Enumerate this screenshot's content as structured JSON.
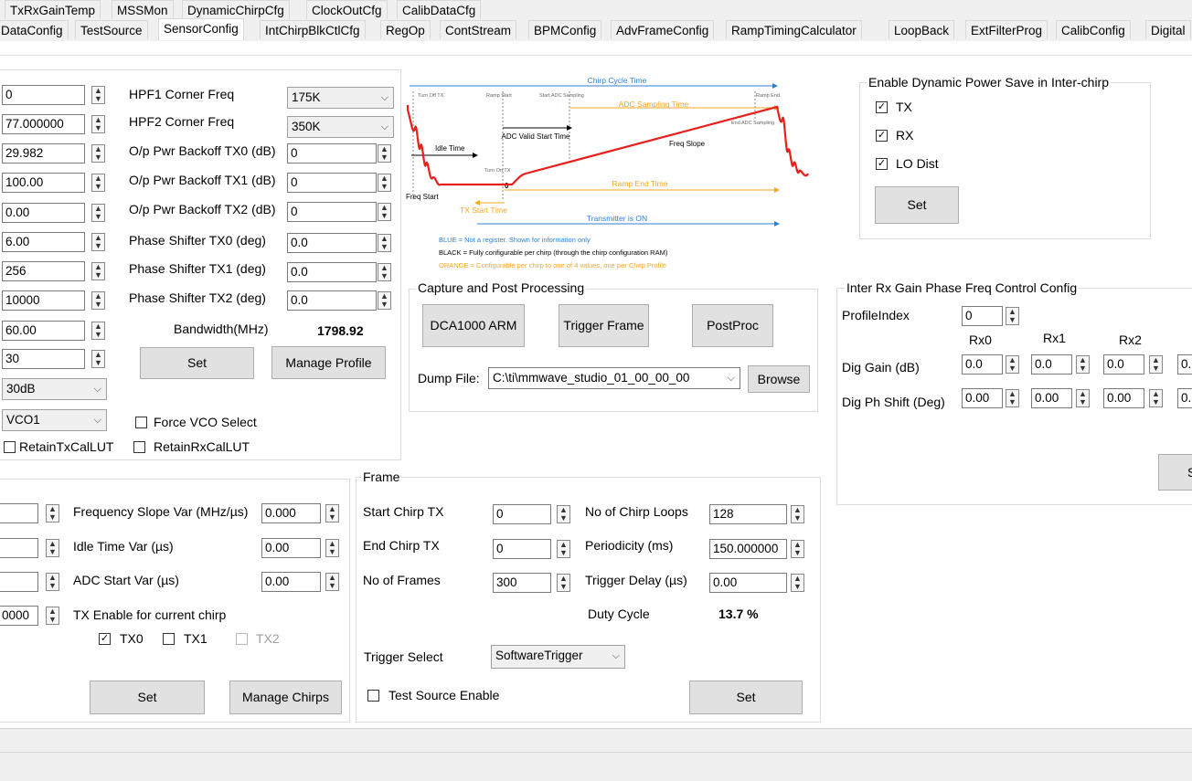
{
  "tabs_row1": [
    "TxRxGainTemp",
    "MSSMon",
    "DynamicChirpCfg",
    "ClockOutCfg",
    "CalibDataCfg"
  ],
  "tabs_row2": [
    "DataConfig",
    "TestSource",
    "SensorConfig",
    "IntChirpBlkCtlCfg",
    "RegOp",
    "ContStream",
    "BPMConfig",
    "AdvFrameConfig",
    "RampTimingCalculator",
    "LoopBack",
    "ExtFilterProg",
    "CalibConfig",
    "Digital"
  ],
  "profile": {
    "values": [
      "0",
      "77.000000",
      "29.982",
      "100.00",
      "0.00",
      "6.00",
      "256",
      "10000",
      "60.00",
      "30"
    ],
    "gain_combo": "30dB",
    "vco_combo": "VCO1",
    "hpf1_label": "HPF1 Corner Freq",
    "hpf1_value": "175K",
    "hpf2_label": "HPF2 Corner Freq",
    "hpf2_value": "350K",
    "backoff_tx0_label": "O/p Pwr Backoff TX0 (dB)",
    "backoff_tx0": "0",
    "backoff_tx1_label": "O/p Pwr Backoff TX1 (dB)",
    "backoff_tx1": "0",
    "backoff_tx2_label": "O/p Pwr Backoff TX2 (dB)",
    "backoff_tx2": "0",
    "ps_tx0_label": "Phase Shifter TX0 (deg)",
    "ps_tx0": "0.0",
    "ps_tx1_label": "Phase Shifter TX1 (deg)",
    "ps_tx1": "0.0",
    "ps_tx2_label": "Phase Shifter TX2 (deg)",
    "ps_tx2": "0.0",
    "bandwidth_label": "Bandwidth(MHz)",
    "bandwidth": "1798.92",
    "set_label": "Set",
    "manage_profile_label": "Manage Profile",
    "force_vco_label": "Force VCO Select",
    "retain_tx_label": "RetainTxCalLUT",
    "retain_rx_label": "RetainRxCalLUT"
  },
  "diagram": {
    "chirp_cycle": "Chirp Cycle Time",
    "turn_off_tx": "Turn Off TX",
    "ramp_start": "Ramp Start",
    "start_adc": "Start ADC Sampling",
    "ramp_end": "Ramp End",
    "adc_sampling": "ADC Sampling Time",
    "end_adc": "End ADC Sampling",
    "adc_valid": "ADC Valid Start Time",
    "idle": "Idle Time",
    "freq_slope": "Freq Slope",
    "turn_on_tx": "Turn On TX",
    "zero": "0",
    "ramp_end_time": "Ramp End Time",
    "freq_start": "Freq Start",
    "tx_start": "TX Start Time",
    "tx_on": "Transmitter is ON",
    "legend_blue": "BLUE = Not a register. Shown for information only",
    "legend_black": "BLACK = Fully configurable per chirp (through the chirp configuration RAM)",
    "legend_orange": "ORANGE = Configurable per chirp to one of 4 values, one per Chirp Profile",
    "color_blue": "#2f7fd6",
    "color_orange": "#f5a623",
    "color_red": "#e8201c"
  },
  "capture": {
    "title": "Capture and Post Processing",
    "dca": "DCA1000 ARM",
    "trigger": "Trigger Frame",
    "postproc": "PostProc",
    "dump_label": "Dump File:",
    "dump_value": "C:\\ti\\mmwave_studio_01_00_00_00",
    "browse": "Browse"
  },
  "powersave": {
    "title": "Enable Dynamic Power Save in Inter-chirp",
    "tx": "TX",
    "rx": "RX",
    "lo": "LO Dist",
    "set": "Set"
  },
  "interrx": {
    "title": "Inter Rx Gain Phase Freq Control Config",
    "profile_label": "ProfileIndex",
    "profile_value": "0",
    "rx0": "Rx0",
    "rx1": "Rx1",
    "rx2": "Rx2",
    "gain_label": "Dig Gain (dB)",
    "gain_values": [
      "0.0",
      "0.0",
      "0.0",
      "0."
    ],
    "phase_label": "Dig Ph Shift (Deg)",
    "phase_values": [
      "0.00",
      "0.00",
      "0.00",
      "0."
    ],
    "set_partial": "S"
  },
  "chirp": {
    "freq_slope_label": "Frequency Slope Var (MHz/µs)",
    "freq_slope": "0.000",
    "idle_label": "Idle Time Var (µs)",
    "idle": "0.00",
    "adc_label": "ADC Start Var (µs)",
    "adc": "0.00",
    "tx_enable_label": "TX Enable for current chirp",
    "left_value": "0000",
    "tx0": "TX0",
    "tx1": "TX1",
    "tx2": "TX2",
    "set": "Set",
    "manage": "Manage Chirps"
  },
  "frame": {
    "title": "Frame",
    "start_label": "Start Chirp TX",
    "start": "0",
    "end_label": "End Chirp TX",
    "end": "0",
    "frames_label": "No of Frames",
    "frames": "300",
    "loops_label": "No of Chirp Loops",
    "loops": "128",
    "period_label": "Periodicity (ms)",
    "period": "150.000000",
    "delay_label": "Trigger Delay (µs)",
    "delay": "0.00",
    "duty_label": "Duty Cycle",
    "duty": "13.7 %",
    "trigger_label": "Trigger Select",
    "trigger": "SoftwareTrigger",
    "test_label": "Test Source Enable",
    "set": "Set"
  }
}
